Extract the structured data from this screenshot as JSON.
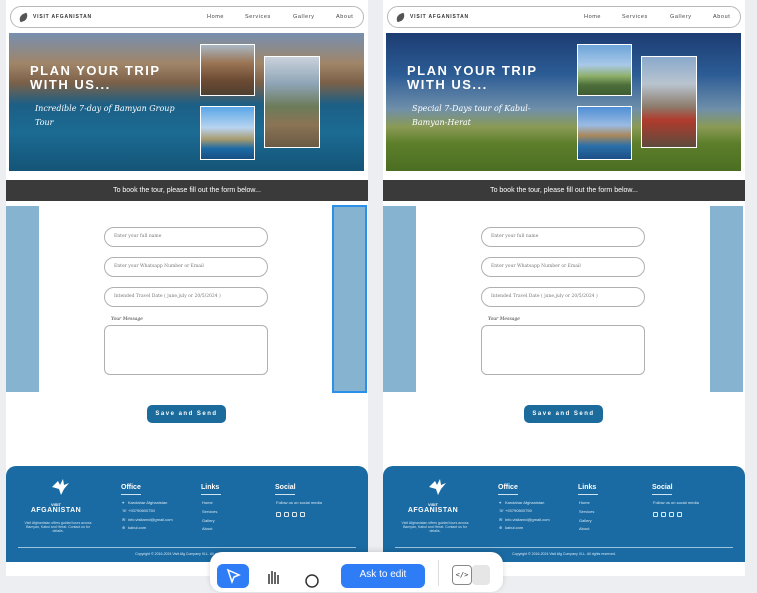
{
  "nav": {
    "logo_text": "VISIT AFGANISTAN",
    "links": [
      "Home",
      "Services",
      "Gallery",
      "About"
    ]
  },
  "boards": [
    {
      "hero_title": "PLAN YOUR TRIP WITH US...",
      "hero_subtitle": "Incredible 7-day of Bamyan Group Tour"
    },
    {
      "hero_title": "PLAN YOUR TRIP WITH US...",
      "hero_subtitle": "Special 7-Days tour of Kabul-Bamyan-Herat"
    }
  ],
  "form": {
    "banner": "To book the tour, please fill out the form below...",
    "name_placeholder": "Enter your full name",
    "contact_placeholder": "Enter your Whatsapp Number or Email",
    "date_placeholder": "Intended Travel Date ( june,july or 20/5/2024 )",
    "message_label": "Your Message",
    "submit_label": "Save and Send"
  },
  "footer": {
    "brand_small": "VISIT",
    "brand_large": "AFGANISTAN",
    "description": "Visit Afghanistan offers guided tours across Bamyan, Kabul and Herat. Contact us for details.",
    "office_heading": "Office",
    "office_items": [
      "Kandahar Afghanistan",
      "+93790600750",
      "info.visitarnd@gmail.com",
      "kabul.com"
    ],
    "links_heading": "Links",
    "links_items": [
      "Home",
      "Services",
      "Gallery",
      "About"
    ],
    "social_heading": "Social",
    "social_text": "Follow us on social media",
    "copyright": "Copyright © 2016-2024 Visit Afg Company XLL. All rights reserved."
  },
  "toolbar": {
    "ask_label": "Ask to edit",
    "code_glyph": "</>"
  },
  "colors": {
    "accent": "#1b6b9c",
    "sidebar_blue": "#86b4d0",
    "selection": "#2b90ea",
    "toolbar_blue": "#2f7df6"
  }
}
